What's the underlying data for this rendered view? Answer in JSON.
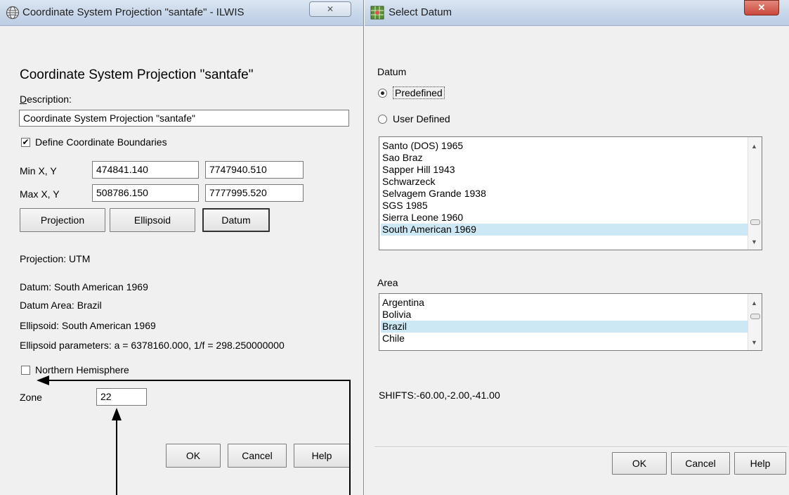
{
  "left_window": {
    "title": "Coordinate System Projection \"santafe\" - ILWIS",
    "heading": "Coordinate System Projection \"santafe\"",
    "description_label": "Description:",
    "description_value": "Coordinate System Projection \"santafe\"",
    "define_boundaries_label": "Define Coordinate Boundaries",
    "define_boundaries_checked": true,
    "min_label": "Min X, Y",
    "min_x": "474841.140",
    "min_y": "7747940.510",
    "max_label": "Max X, Y",
    "max_x": "508786.150",
    "max_y": "7777995.520",
    "projection_button": "Projection",
    "ellipsoid_button": "Ellipsoid",
    "datum_button": "Datum",
    "info_projection": "Projection: UTM",
    "info_datum": "Datum: South American 1969",
    "info_datum_area": "Datum Area: Brazil",
    "info_ellipsoid": "Ellipsoid: South American 1969",
    "info_ellipsoid_params": "Ellipsoid parameters: a = 6378160.000, 1/f = 298.250000000",
    "northern_hemisphere_label": "Northern Hemisphere",
    "northern_hemisphere_checked": false,
    "zone_label": "Zone",
    "zone_value": "22",
    "ok_button": "OK",
    "cancel_button": "Cancel",
    "help_button": "Help",
    "close_glyph": "✕"
  },
  "right_window": {
    "title": "Select Datum",
    "datum_label": "Datum",
    "predefined_label": "Predefined",
    "user_defined_label": "User Defined",
    "datum_list": [
      "Santo (DOS) 1965",
      "Sao Braz",
      "Sapper Hill 1943",
      "Schwarzeck",
      "Selvagem Grande 1938",
      "SGS 1985",
      "Sierra Leone 1960",
      "South American 1969"
    ],
    "datum_selected": "South American 1969",
    "area_label": "Area",
    "area_list": [
      "Argentina",
      "Bolivia",
      "Brazil",
      "Chile"
    ],
    "area_selected": "Brazil",
    "shifts_text": "SHIFTS:-60.00,-2.00,-41.00",
    "ok_button": "OK",
    "cancel_button": "Cancel",
    "help_button": "Help",
    "close_glyph": "✕"
  },
  "colors": {
    "selection": "#cce8f5",
    "close_button": "#c9483c",
    "dialog_bg": "#f0f0f0"
  },
  "icons": {
    "left_title_icon": "globe-icon",
    "right_title_icon": "ilwis-app-icon"
  }
}
